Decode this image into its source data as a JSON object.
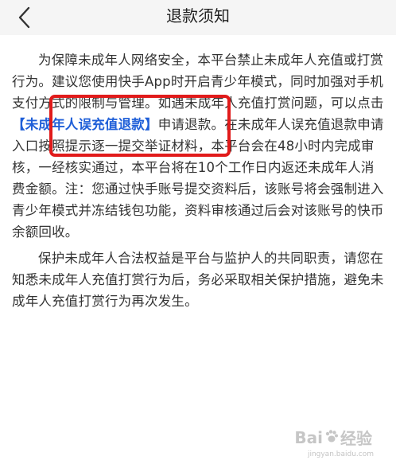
{
  "header": {
    "title": "退款须知",
    "back_icon": "chevron-left-icon"
  },
  "content": {
    "p1_before": "为保障未成年人网络安全，本平台禁止未成年人充值或打赏行为。建议您使用快手App时开启青少年模式，同时加强对手机支付方式的限制与管理。如遇未成年人充值打赏问题，可以点击",
    "p1_link": "【未成年人误充值退款】",
    "p1_after": "申请退款。在未成年人误充值退款申请入口按照提示逐一提交举证材料，本平台会在48小时内完成审核，一经核实通过，本平台将在10个工作日内返还未成年人消费金额。注：您通过快手账号提交资料后，该账号将会强制进入青少年模式并冻结钱包功能，资料审核通过后会对该账号的快币余额回收。",
    "p2": "保护未成年人合法权益是平台与监护人的共同职责，请您在知悉未成年人充值打赏行为后，务必采取相关保护措施，避免未成年人充值打赏行为再次发生。"
  },
  "watermark": {
    "text_left": "Bai",
    "text_right": "经验",
    "sub": "jingyan.baidu.com"
  },
  "colors": {
    "link": "#1f5fd8",
    "highlight_box": "#e11b1b",
    "header_bg": "#f5f5f5"
  }
}
